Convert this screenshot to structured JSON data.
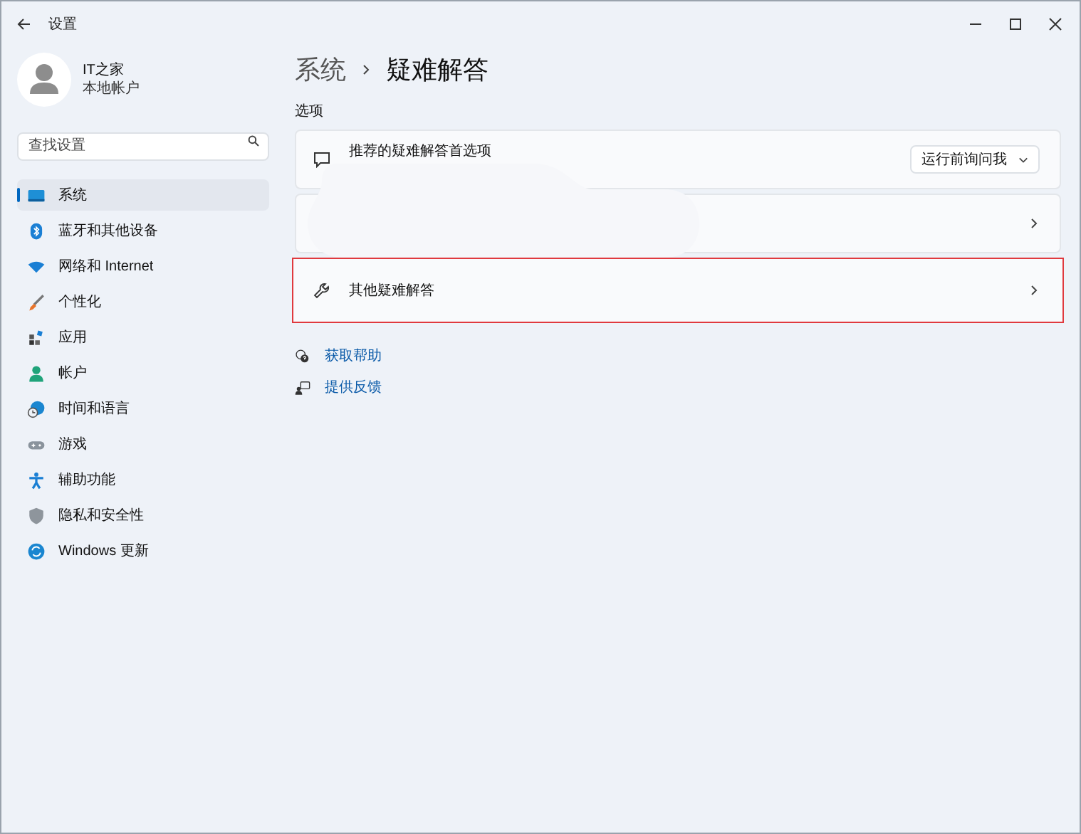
{
  "window": {
    "title": "设置"
  },
  "user": {
    "name": "IT之家",
    "account": "本地帐户"
  },
  "search": {
    "placeholder": "查找设置"
  },
  "nav": [
    {
      "label": "系统",
      "selected": true
    },
    {
      "label": "蓝牙和其他设备",
      "selected": false
    },
    {
      "label": "网络和 Internet",
      "selected": false
    },
    {
      "label": "个性化",
      "selected": false
    },
    {
      "label": "应用",
      "selected": false
    },
    {
      "label": "帐户",
      "selected": false
    },
    {
      "label": "时间和语言",
      "selected": false
    },
    {
      "label": "游戏",
      "selected": false
    },
    {
      "label": "辅助功能",
      "selected": false
    },
    {
      "label": "隐私和安全性",
      "selected": false
    },
    {
      "label": "Windows 更新",
      "selected": false
    }
  ],
  "breadcrumb": [
    "系统",
    "疑难解答"
  ],
  "section": "选项",
  "cards": [
    {
      "kind": "dropdown",
      "label": "推荐的疑难解答首选项",
      "value": "运行前询问我",
      "highlighted": false
    },
    {
      "kind": "redacted",
      "highlighted": false
    },
    {
      "kind": "link",
      "label": "其他疑难解答",
      "highlighted": true
    }
  ],
  "links": [
    "获取帮助",
    "提供反馈"
  ]
}
